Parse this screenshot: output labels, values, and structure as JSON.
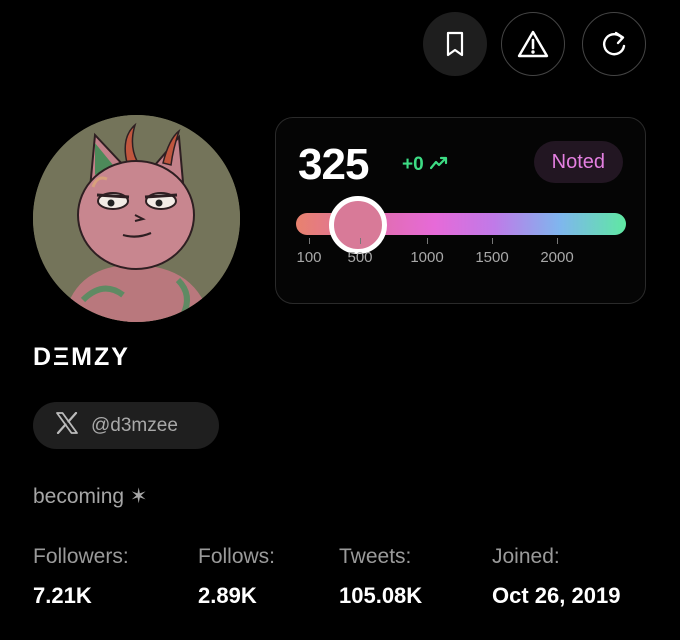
{
  "header": {
    "actions": [
      {
        "icon": "bookmark-icon"
      },
      {
        "icon": "warning-icon"
      },
      {
        "icon": "refresh-icon"
      }
    ]
  },
  "score": {
    "value": "325",
    "delta": "+0",
    "trend_icon": "trending-up-icon",
    "badge": "Noted",
    "slider": {
      "current": 325,
      "ticks": [
        "100",
        "500",
        "1000",
        "1500",
        "2000"
      ]
    }
  },
  "profile": {
    "display_name": "DΞMZY",
    "platform_icon": "x-logo-icon",
    "handle": "@d3mzee",
    "bio": "becoming ✶"
  },
  "stats": [
    {
      "label": "Followers:",
      "value": "7.21K"
    },
    {
      "label": "Follows:",
      "value": "2.89K"
    },
    {
      "label": "Tweets:",
      "value": "105.08K"
    },
    {
      "label": "Joined:",
      "value": "Oct 26, 2019"
    }
  ],
  "colors": {
    "accent_green": "#3ddc84",
    "badge_text": "#e37fe0",
    "thumb": "#d87a98"
  }
}
